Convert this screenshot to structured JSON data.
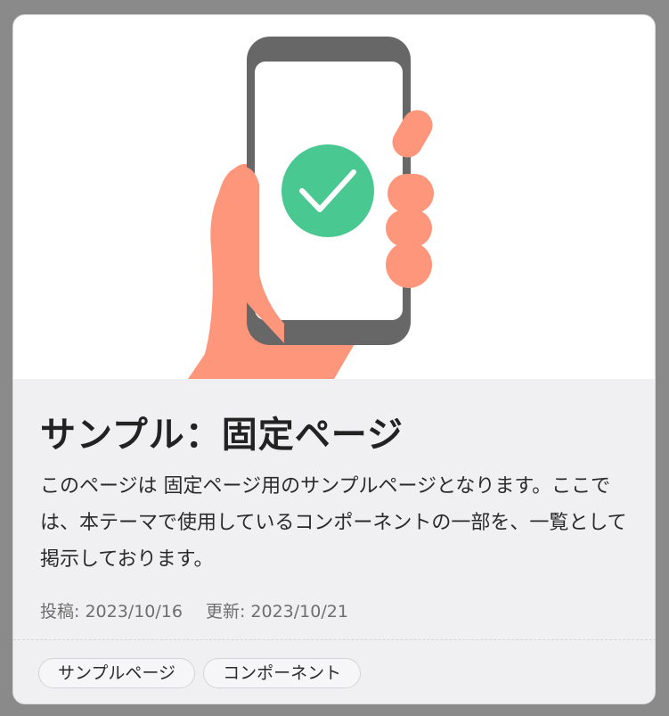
{
  "post": {
    "title": "サンプル：固定ページ",
    "description": "このページは 固定ページ用のサンプルページとなります。ここでは、本テーマで使用しているコンポーネントの一部を、一覧として掲示しております。",
    "posted_label": "投稿:",
    "posted_date": "2023/10/16",
    "updated_label": "更新:",
    "updated_date": "2023/10/21"
  },
  "tags": [
    {
      "label": "サンプルページ"
    },
    {
      "label": "コンポーネント"
    }
  ],
  "illustration": {
    "icon": "check-icon",
    "colors": {
      "phone": "#676767",
      "screen": "#ffffff",
      "hand": "#fe967c",
      "check_circle": "#4ac892",
      "check_mark": "#ffffff"
    }
  }
}
